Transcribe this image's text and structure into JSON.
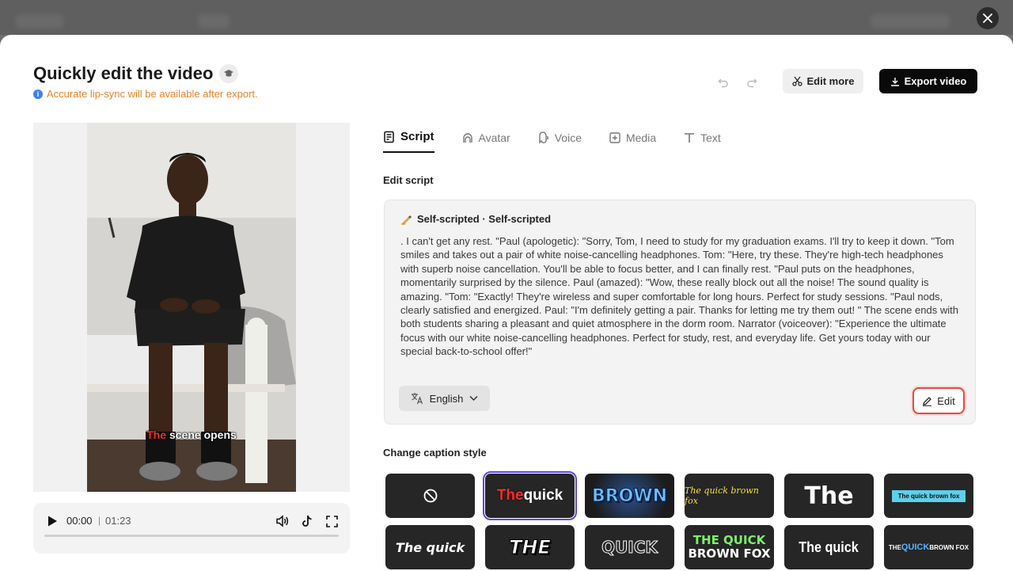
{
  "modal": {
    "title": "Quickly edit the video",
    "notice": "Accurate lip-sync will be available after export.",
    "edit_more_label": "Edit more",
    "export_label": "Export video"
  },
  "player": {
    "current_time": "00:00",
    "separator": "|",
    "total_time": "01:23",
    "progress": 0,
    "caption_highlight": "The",
    "caption_rest": " scene opens"
  },
  "tabs": [
    {
      "label": "Script",
      "icon": "script-icon",
      "active": true
    },
    {
      "label": "Avatar",
      "icon": "avatar-icon",
      "active": false
    },
    {
      "label": "Voice",
      "icon": "voice-icon",
      "active": false
    },
    {
      "label": "Media",
      "icon": "media-icon",
      "active": false
    },
    {
      "label": "Text",
      "icon": "text-icon",
      "active": false
    }
  ],
  "script": {
    "section_label": "Edit script",
    "header": "Self-scripted · Self-scripted",
    "body": ". I can't get any rest. \"Paul (apologetic): \"Sorry, Tom, I need to study for my graduation exams. I'll try to keep it down. \"Tom smiles and takes out a pair of white noise-cancelling headphones. Tom: \"Here, try these. They're high-tech headphones with superb noise cancellation. You'll be able to focus better, and I can finally rest. \"Paul puts on the headphones, momentarily surprised by the silence. Paul (amazed): \"Wow, these really block out all the noise! The sound quality is amazing. \"Tom: \"Exactly! They're wireless and super comfortable for long hours. Perfect for study sessions. \"Paul nods, clearly satisfied and energized. Paul: \"I'm definitely getting a pair. Thanks for letting me try them out! \" The scene ends with both students sharing a pleasant and quiet atmosphere in the dorm room. Narrator (voiceover): \"Experience the ultimate focus with our white noise-cancelling headphones. Perfect for study, rest, and everyday life. Get yours today with our special back-to-school offer!\"",
    "language": "English",
    "edit_label": "Edit"
  },
  "caption_style": {
    "section_label": "Change caption style",
    "tiles": [
      {
        "id": "none",
        "text": ""
      },
      {
        "id": "red-the-quick",
        "text_a": "The",
        "text_b": " quick"
      },
      {
        "id": "brown-blue",
        "text": "BROWN"
      },
      {
        "id": "yellow-script",
        "text": "The quick brown fox"
      },
      {
        "id": "big-the",
        "text": "The"
      },
      {
        "id": "cyan-box",
        "text": "The quick brown fox"
      },
      {
        "id": "italic-the-quick",
        "text": "The quick"
      },
      {
        "id": "the-italic-outline",
        "text": "THE"
      },
      {
        "id": "quick-outline",
        "text": "QUICK"
      },
      {
        "id": "green-quick-brown",
        "text_a": "THE QUICK",
        "text_b": "BROWN FOX"
      },
      {
        "id": "condensed-the-quick",
        "text": "The quick"
      },
      {
        "id": "blue-quick",
        "text_a": "THE ",
        "text_b": "QUICK",
        "text_c": " BROWN FOX"
      }
    ]
  },
  "colors": {
    "accent_purple": "#5b4bd6",
    "notice_orange": "#e8832a",
    "edit_highlight_red": "#e34b3c",
    "export_black": "#0a0a0a"
  }
}
